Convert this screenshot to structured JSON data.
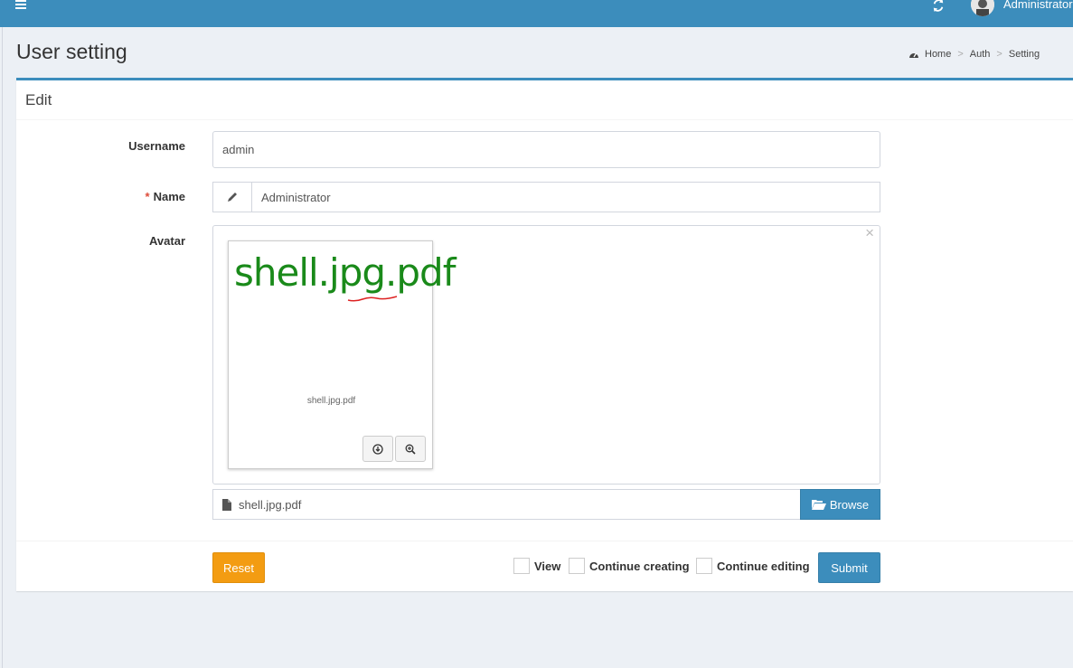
{
  "header": {
    "user_name": "Administrator",
    "icons": [
      "hamburger-icon",
      "refresh-icon",
      "avatar"
    ]
  },
  "page": {
    "title": "User setting",
    "breadcrumb": [
      "Home",
      "Auth",
      "Setting"
    ]
  },
  "form": {
    "box_title": "Edit",
    "username_label": "Username",
    "username_value": "admin",
    "name_required": "*",
    "name_label": "Name",
    "name_value": "Administrator",
    "avatar_label": "Avatar",
    "preview_big_text": "shell.jpg.pdf",
    "preview_caption": "shell.jpg.pdf",
    "file_name": "shell.jpg.pdf",
    "browse_label": "Browse"
  },
  "footer": {
    "reset_label": "Reset",
    "checks": [
      "View",
      "Continue creating",
      "Continue editing"
    ],
    "submit_label": "Submit"
  },
  "colors": {
    "primary": "#3c8dbc",
    "warning": "#f39c12",
    "required": "#dd4b39",
    "preview_text": "#1a8a1a"
  }
}
